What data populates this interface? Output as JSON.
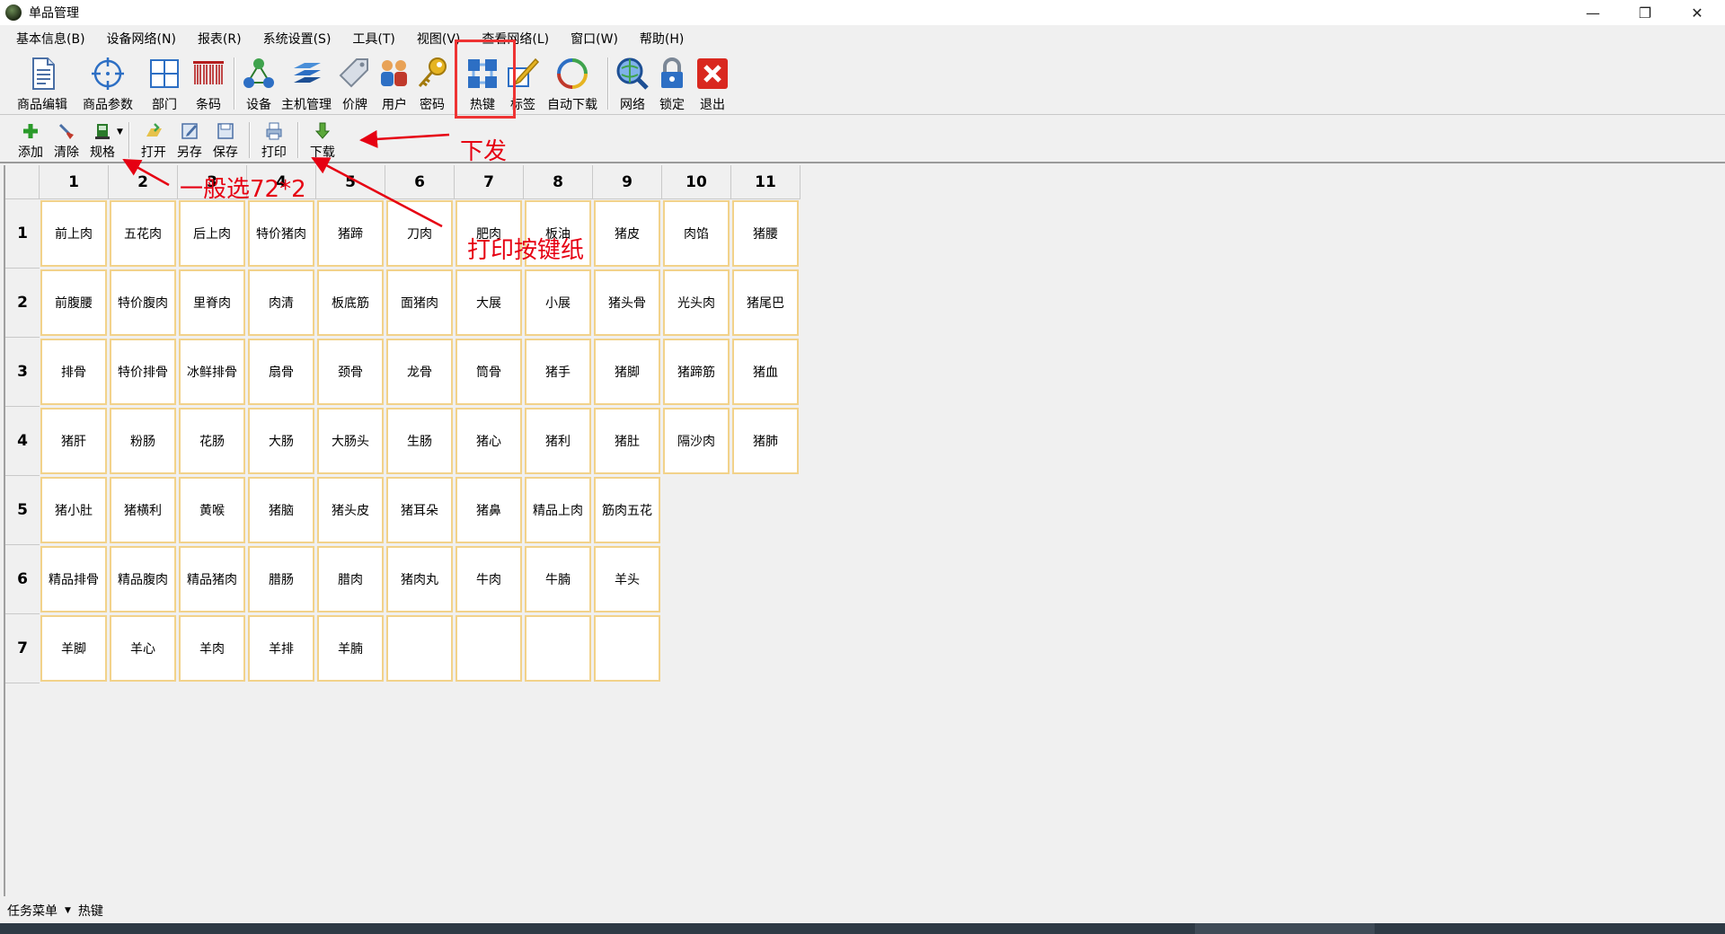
{
  "window": {
    "title": "单品管理",
    "minimize": "—",
    "restore": "❐",
    "close": "✕"
  },
  "menu": [
    "基本信息(B)",
    "设备网络(N)",
    "报表(R)",
    "系统设置(S)",
    "工具(T)",
    "视图(V)",
    "查看网络(L)",
    "窗口(W)",
    "帮助(H)"
  ],
  "toolbar_main": [
    {
      "label": "商品编辑",
      "icon": "document-icon"
    },
    {
      "label": "商品参数",
      "icon": "crosshair-icon"
    },
    {
      "label": "部门",
      "icon": "grid-icon"
    },
    {
      "label": "条码",
      "icon": "barcode-icon"
    },
    {
      "label": "设备",
      "icon": "network-icon"
    },
    {
      "label": "主机管理",
      "icon": "stack-icon"
    },
    {
      "label": "价牌",
      "icon": "tag-icon"
    },
    {
      "label": "用户",
      "icon": "users-icon"
    },
    {
      "label": "密码",
      "icon": "key-icon"
    },
    {
      "label": "热键",
      "icon": "hotkey-grid-icon"
    },
    {
      "label": "标签",
      "icon": "pen-icon"
    },
    {
      "label": "自动下载",
      "icon": "refresh-icon"
    },
    {
      "label": "网络",
      "icon": "magnifier-globe-icon"
    },
    {
      "label": "锁定",
      "icon": "lock-icon"
    },
    {
      "label": "退出",
      "icon": "exit-icon"
    }
  ],
  "toolbar_sub": [
    {
      "label": "添加",
      "icon": "plus-icon"
    },
    {
      "label": "清除",
      "icon": "broom-icon"
    },
    {
      "label": "规格",
      "icon": "spec-icon"
    },
    {
      "label": "打开",
      "icon": "open-icon"
    },
    {
      "label": "另存",
      "icon": "save-as-icon"
    },
    {
      "label": "保存",
      "icon": "save-icon"
    },
    {
      "label": "打印",
      "icon": "print-icon"
    },
    {
      "label": "下载",
      "icon": "download-arrow-icon"
    }
  ],
  "grid": {
    "columns": [
      "1",
      "2",
      "3",
      "4",
      "5",
      "6",
      "7",
      "8",
      "9",
      "10",
      "11"
    ],
    "rows": [
      {
        "label": "1",
        "cells": [
          "前上肉",
          "五花肉",
          "后上肉",
          "特价猪肉",
          "猪蹄",
          "刀肉",
          "肥肉",
          "板油",
          "猪皮",
          "肉馅",
          "猪腰"
        ]
      },
      {
        "label": "2",
        "cells": [
          "前腹腰",
          "特价腹肉",
          "里脊肉",
          "肉清",
          "板底筋",
          "面猪肉",
          "大展",
          "小展",
          "猪头骨",
          "光头肉",
          "猪尾巴"
        ]
      },
      {
        "label": "3",
        "cells": [
          "排骨",
          "特价排骨",
          "冰鲜排骨",
          "扇骨",
          "颈骨",
          "龙骨",
          "筒骨",
          "猪手",
          "猪脚",
          "猪蹄筋",
          "猪血"
        ]
      },
      {
        "label": "4",
        "cells": [
          "猪肝",
          "粉肠",
          "花肠",
          "大肠",
          "大肠头",
          "生肠",
          "猪心",
          "猪利",
          "猪肚",
          "隔沙肉",
          "猪肺"
        ]
      },
      {
        "label": "5",
        "cells": [
          "猪小肚",
          "猪横利",
          "黄喉",
          "猪脑",
          "猪头皮",
          "猪耳朵",
          "猪鼻",
          "精品上肉",
          "筋肉五花"
        ]
      },
      {
        "label": "6",
        "cells": [
          "精品排骨",
          "精品腹肉",
          "精品猪肉",
          "腊肠",
          "腊肉",
          "猪肉丸",
          "牛肉",
          "牛腩",
          "羊头"
        ]
      },
      {
        "label": "7",
        "cells": [
          "羊脚",
          "羊心",
          "羊肉",
          "羊排",
          "羊腩",
          "",
          "",
          "",
          ""
        ]
      }
    ]
  },
  "annotations": {
    "download": "下发",
    "spec_hint": "一般选72*2",
    "print_hint": "打印按键纸"
  },
  "statusbar": {
    "menu_label": "任务菜单",
    "current": "热键"
  },
  "colors": {
    "cell_border": "#f2d28a",
    "annotation": "#e60012"
  }
}
